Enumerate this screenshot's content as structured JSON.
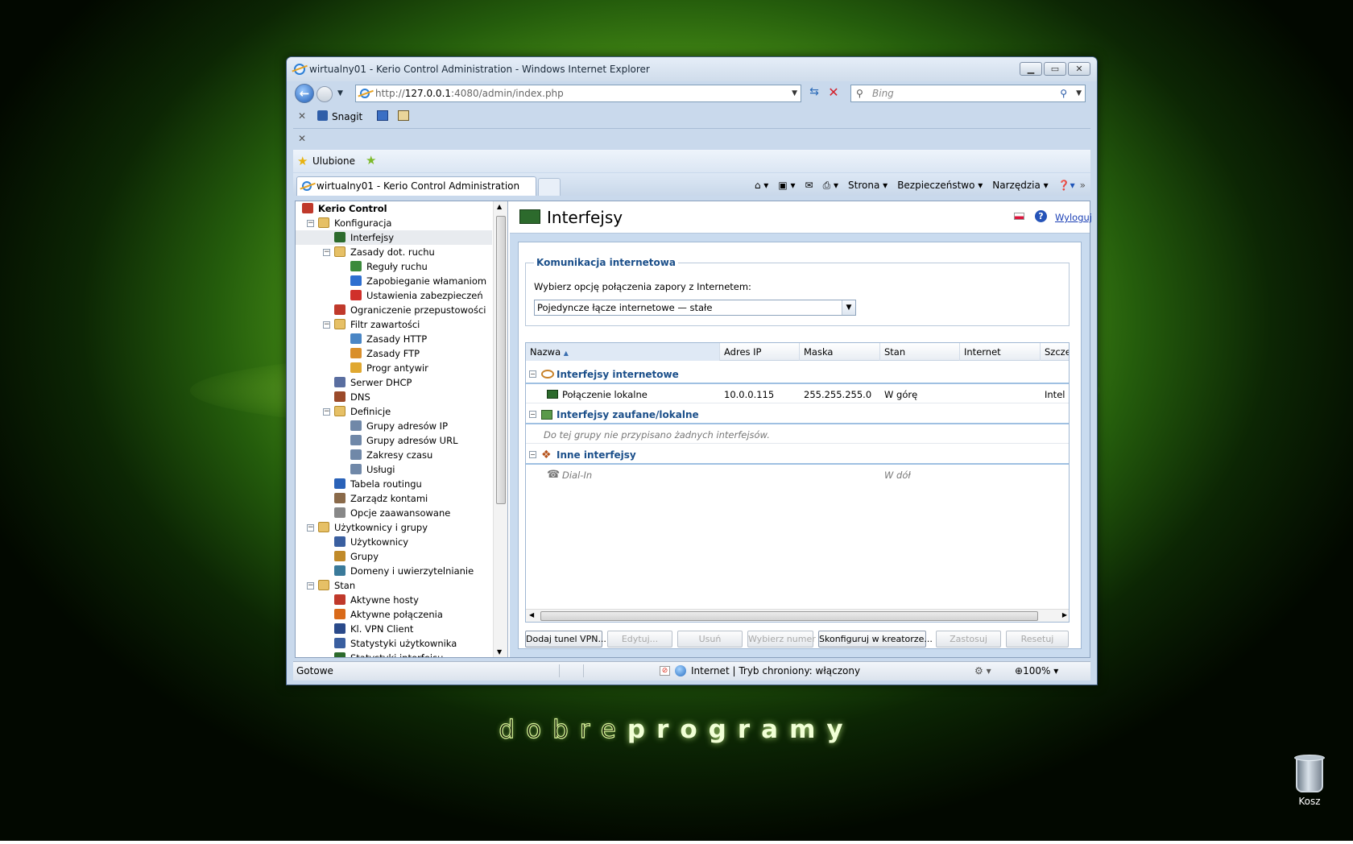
{
  "desktop": {
    "brand_light": "dobre",
    "brand_bold": "programy",
    "recycle_label": "Kosz"
  },
  "browser": {
    "window_title": "wirtualny01 - Kerio Control Administration - Windows Internet Explorer",
    "address_prefix": "http://",
    "address_host": "127.0.0.1",
    "address_rest": ":4080/admin/index.php",
    "search_placeholder": "Bing",
    "toolbar_snagit": "Snagit",
    "favorites_label": "Ulubione",
    "tab_title": "wirtualny01 - Kerio Control Administration",
    "cmd": {
      "page": "Strona",
      "safety": "Bezpieczeństwo",
      "tools": "Narzędzia"
    },
    "status": {
      "ready": "Gotowe",
      "zone": "Internet | Tryb chroniony: włączony",
      "zoom": "100%"
    }
  },
  "tree": [
    {
      "label": "Kerio Control",
      "icon": "kerio-icon",
      "indent": 0,
      "bold": true
    },
    {
      "label": "Konfiguracja",
      "icon": "folder-icon",
      "indent": 1,
      "exp": "⊟"
    },
    {
      "label": "Interfejsy",
      "icon": "network-card-icon",
      "indent": 2,
      "selected": true
    },
    {
      "label": "Zasady dot. ruchu",
      "icon": "folder-icon",
      "indent": 2,
      "exp": "⊟"
    },
    {
      "label": "Reguły ruchu",
      "icon": "traffic-rules-icon",
      "indent": 3
    },
    {
      "label": "Zapobieganie włamaniom",
      "icon": "shield-icon",
      "indent": 3
    },
    {
      "label": "Ustawienia zabezpieczeń",
      "icon": "security-settings-icon",
      "indent": 3
    },
    {
      "label": "Ograniczenie przepustowości",
      "icon": "bandwidth-icon",
      "indent": 2
    },
    {
      "label": "Filtr zawartości",
      "icon": "folder-icon",
      "indent": 2,
      "exp": "⊟"
    },
    {
      "label": "Zasady HTTP",
      "icon": "http-icon",
      "indent": 3
    },
    {
      "label": "Zasady FTP",
      "icon": "ftp-icon",
      "indent": 3
    },
    {
      "label": "Progr antywir",
      "icon": "antivirus-icon",
      "indent": 3
    },
    {
      "label": "Serwer DHCP",
      "icon": "dhcp-icon",
      "indent": 2
    },
    {
      "label": "DNS",
      "icon": "dns-icon",
      "indent": 2
    },
    {
      "label": "Definicje",
      "icon": "folder-icon",
      "indent": 2,
      "exp": "⊟"
    },
    {
      "label": "Grupy adresów IP",
      "icon": "ip-group-icon",
      "indent": 3
    },
    {
      "label": "Grupy adresów URL",
      "icon": "url-group-icon",
      "indent": 3
    },
    {
      "label": "Zakresy czasu",
      "icon": "time-range-icon",
      "indent": 3
    },
    {
      "label": "Usługi",
      "icon": "services-icon",
      "indent": 3
    },
    {
      "label": "Tabela routingu",
      "icon": "routing-icon",
      "indent": 2
    },
    {
      "label": "Zarządz kontami",
      "icon": "accounts-icon",
      "indent": 2
    },
    {
      "label": "Opcje zaawansowane",
      "icon": "advanced-icon",
      "indent": 2
    },
    {
      "label": "Użytkownicy i grupy",
      "icon": "folder-icon",
      "indent": 1,
      "exp": "⊟"
    },
    {
      "label": "Użytkownicy",
      "icon": "user-icon",
      "indent": 2
    },
    {
      "label": "Grupy",
      "icon": "group-icon",
      "indent": 2
    },
    {
      "label": "Domeny i uwierzytelnianie",
      "icon": "domain-icon",
      "indent": 2
    },
    {
      "label": "Stan",
      "icon": "folder-icon",
      "indent": 1,
      "exp": "⊟"
    },
    {
      "label": "Aktywne hosty",
      "icon": "hosts-icon",
      "indent": 2
    },
    {
      "label": "Aktywne połączenia",
      "icon": "connections-icon",
      "indent": 2
    },
    {
      "label": "Kl. VPN Client",
      "icon": "vpn-icon",
      "indent": 2
    },
    {
      "label": "Statystyki użytkownika",
      "icon": "user-stats-icon",
      "indent": 2
    },
    {
      "label": "Statystyki interfejsu",
      "icon": "iface-stats-icon",
      "indent": 2
    }
  ],
  "page": {
    "title": "Interfejsy",
    "logout": "Wyloguj",
    "fieldset_legend": "Komunikacja internetowa",
    "connect_label": "Wybierz opcję połączenia zapory z Internetem:",
    "connect_value": "Pojedyncze łącze internetowe — stałe",
    "columns": [
      "Nazwa",
      "Adres IP",
      "Maska",
      "Stan",
      "Internet",
      "Szcze"
    ],
    "group1": "Interfejsy internetowe",
    "row1": {
      "name": "Połączenie lokalne",
      "ip": "10.0.0.115",
      "mask": "255.255.255.0",
      "state": "W górę",
      "internet": "",
      "detail": "Intel"
    },
    "group2": "Interfejsy zaufane/lokalne",
    "group2_empty": "Do tej grupy nie przypisano żadnych interfejsów.",
    "group3": "Inne interfejsy",
    "row3": {
      "name": "Dial-In",
      "state": "W dół"
    },
    "buttons": {
      "vpn": "Dodaj tunel VPN...",
      "edit": "Edytuj...",
      "delete": "Usuń",
      "dial": "Wybierz numer",
      "wizard": "Skonfiguruj w kreatorze...",
      "apply": "Zastosuj",
      "reset": "Resetuj"
    }
  }
}
